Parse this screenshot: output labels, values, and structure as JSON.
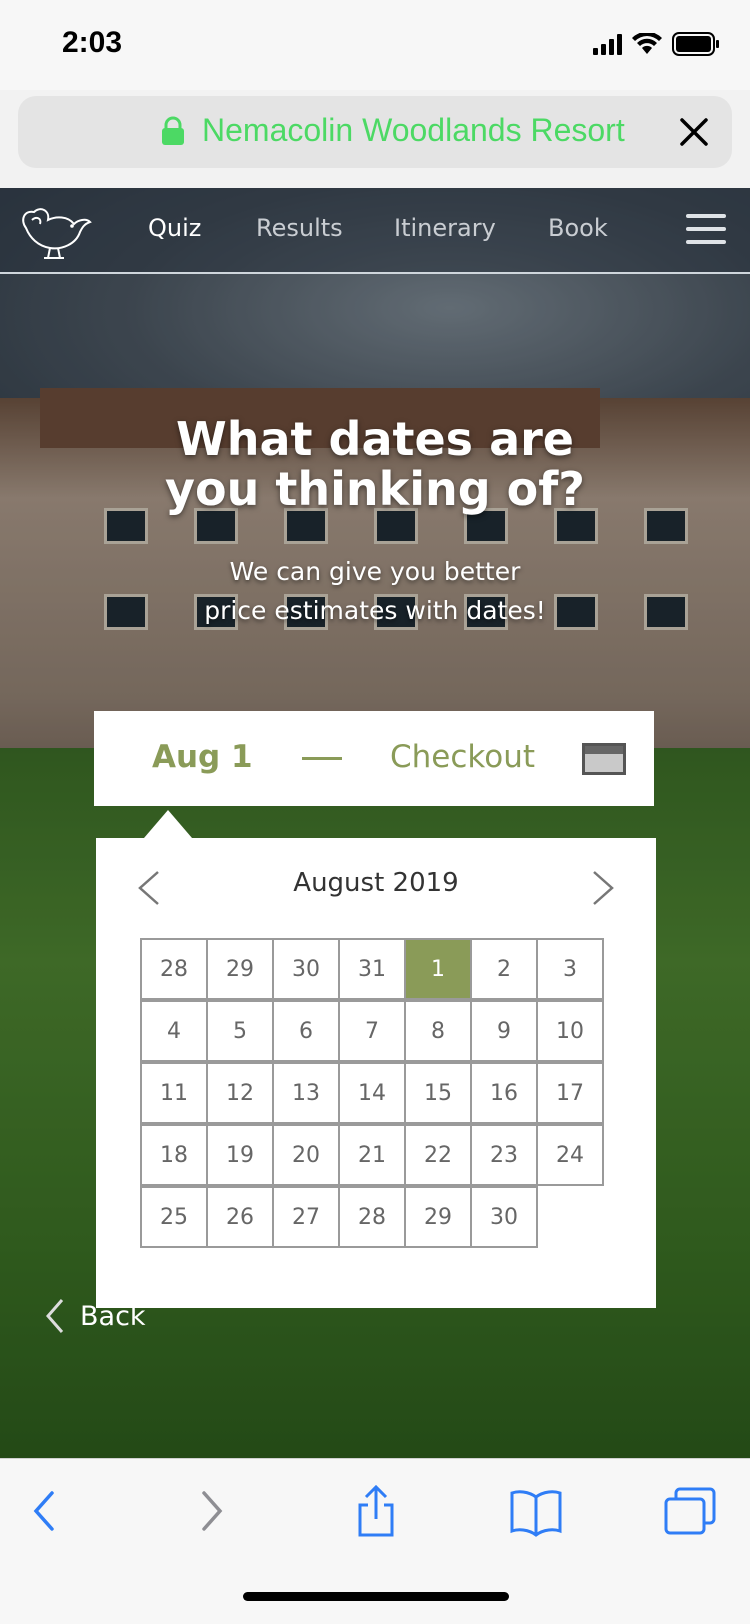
{
  "status_bar": {
    "time": "2:03"
  },
  "url_bar": {
    "site_name": "Nemacolin Woodlands Resort"
  },
  "nav": {
    "items": [
      {
        "label": "Quiz",
        "active": true
      },
      {
        "label": "Results",
        "active": false
      },
      {
        "label": "Itinerary",
        "active": false
      },
      {
        "label": "Book",
        "active": false
      }
    ]
  },
  "hero": {
    "title_line1": "What dates are",
    "title_line2": "you thinking of?",
    "subtitle_line1": "We can give you better",
    "subtitle_line2": "price estimates with dates!"
  },
  "date_picker": {
    "start": "Aug 1",
    "end": "Checkout"
  },
  "calendar": {
    "month_label": "August 2019",
    "selected": "1",
    "weeks": [
      [
        "28",
        "29",
        "30",
        "31",
        "1",
        "2",
        "3"
      ],
      [
        "4",
        "5",
        "6",
        "7",
        "8",
        "9",
        "10"
      ],
      [
        "11",
        "12",
        "13",
        "14",
        "15",
        "16",
        "17"
      ],
      [
        "18",
        "19",
        "20",
        "21",
        "22",
        "23",
        "24"
      ],
      [
        "25",
        "26",
        "27",
        "28",
        "29",
        "30"
      ]
    ]
  },
  "back": {
    "label": "Back"
  },
  "colors": {
    "accent": "#8a9b58",
    "url_green": "#4cd964",
    "toolbar_blue": "#2f7df6"
  },
  "icons": {
    "lock": "lock-icon",
    "close": "close-icon",
    "logo": "bird-logo-icon",
    "menu": "hamburger-menu-icon",
    "calendar": "calendar-icon",
    "prev": "chevron-left-icon",
    "next": "chevron-right-icon",
    "share": "share-icon",
    "bookmarks": "bookmarks-icon",
    "tabs": "tabs-icon"
  }
}
